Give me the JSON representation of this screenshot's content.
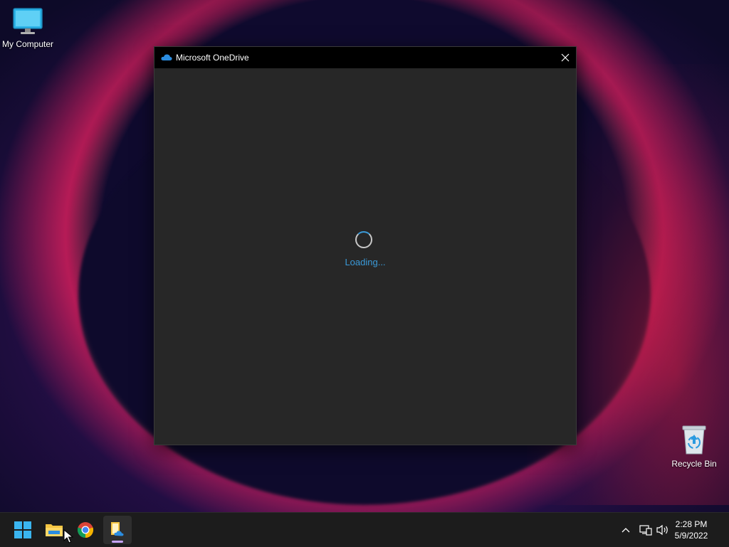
{
  "desktop": {
    "icons": [
      {
        "label": "My Computer",
        "icon": "monitor-icon"
      },
      {
        "label": "Recycle Bin",
        "icon": "recycle-bin-icon"
      }
    ]
  },
  "window": {
    "title": "Microsoft OneDrive",
    "icon": "onedrive-cloud-icon",
    "close_icon": "close-icon",
    "loading_text": "Loading...",
    "accent": "#3a9ad9"
  },
  "taskbar": {
    "apps": [
      {
        "name": "Start",
        "icon": "windows-start-icon"
      },
      {
        "name": "File Explorer",
        "icon": "folder-icon"
      },
      {
        "name": "Google Chrome",
        "icon": "chrome-icon"
      },
      {
        "name": "OneDrive Setup",
        "icon": "onedrive-setup-icon",
        "active": true
      }
    ],
    "tray": {
      "icons": [
        "chevron-up-icon",
        "network-icon",
        "volume-icon"
      ],
      "time": "2:28 PM",
      "date": "5/9/2022"
    }
  }
}
